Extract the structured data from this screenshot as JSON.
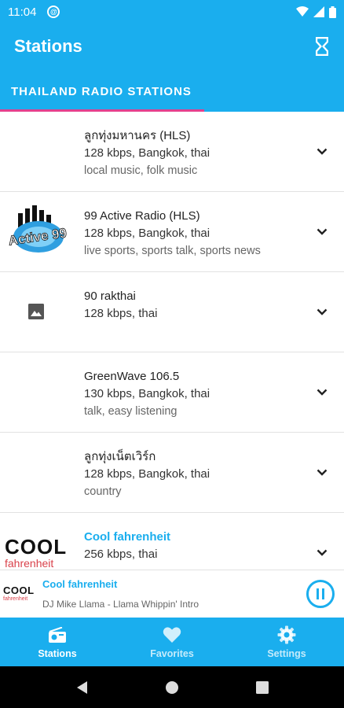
{
  "status_bar": {
    "time": "11:04",
    "sync_icon": "sync-badge-icon",
    "icons": [
      "wifi-icon",
      "signal-icon",
      "battery-icon"
    ]
  },
  "app_bar": {
    "title": "Stations",
    "timer_icon": "hourglass-icon"
  },
  "tabs": [
    {
      "label": "THAILAND RADIO STATIONS",
      "active": true
    }
  ],
  "stations": [
    {
      "name": "ลูกทุ่งมหานคร (HLS)",
      "meta": "128 kbps, Bangkok, thai",
      "tags": "local music, folk music",
      "logo": "none"
    },
    {
      "name": "99 Active Radio (HLS)",
      "meta": "128 kbps, Bangkok, thai",
      "tags": "live sports, sports talk, sports news",
      "logo": "active99-logo",
      "logo_text": "Active 99"
    },
    {
      "name": "90 rakthai",
      "meta": "128 kbps, thai",
      "tags": "",
      "logo": "image-placeholder-icon"
    },
    {
      "name": "GreenWave 106.5",
      "meta": "130 kbps, Bangkok, thai",
      "tags": "talk, easy listening",
      "logo": "none"
    },
    {
      "name": "ลูกทุ่งเน็ตเวิร์ก",
      "meta": "128 kbps, Bangkok, thai",
      "tags": "country",
      "logo": "none"
    },
    {
      "name": "Cool fahrenheit",
      "meta": "256 kbps, thai",
      "tags": "",
      "logo": "cool-fahrenheit-logo",
      "logo_text_top": "COOL",
      "logo_text_bottom": "fahrenheit",
      "active": true
    }
  ],
  "now_playing": {
    "title": "Cool fahrenheit",
    "subtitle": "DJ Mike Llama - Llama Whippin' Intro",
    "logo_text_top": "COOL",
    "logo_text_bottom": "fahrenheit"
  },
  "bottom_nav": [
    {
      "label": "Stations",
      "icon": "radio-icon",
      "active": true
    },
    {
      "label": "Favorites",
      "icon": "heart-icon",
      "active": false
    },
    {
      "label": "Settings",
      "icon": "gear-icon",
      "active": false
    }
  ],
  "colors": {
    "primary": "#1aaeee",
    "tab_indicator": "#e3418d",
    "cool_red": "#d9414a"
  }
}
